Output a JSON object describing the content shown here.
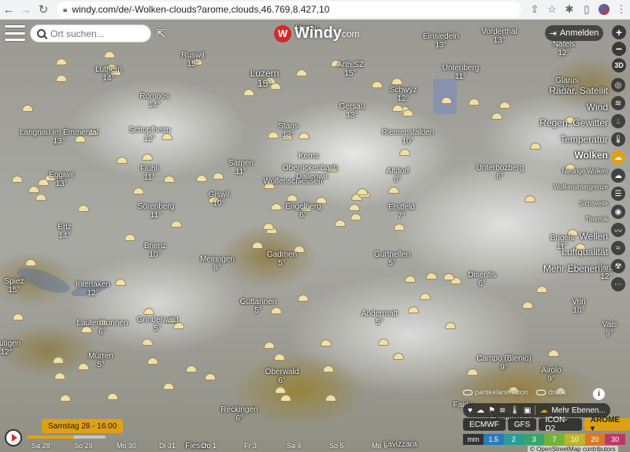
{
  "browser": {
    "url": "windy.com/de/-Wolken-clouds?arome,clouds,46.769,8.427,10"
  },
  "search": {
    "placeholder": "Ort suchen..."
  },
  "logo": {
    "name": "Windy",
    "suffix": "com"
  },
  "login": {
    "label": "Anmelden"
  },
  "zoom": {
    "in": "+",
    "out": "−",
    "mode3d": "3D"
  },
  "layers": [
    {
      "label": "Radar, Satellit",
      "size": "big"
    },
    {
      "label": "Wind",
      "size": "big"
    },
    {
      "label": "Regen, Gewitter",
      "size": "big"
    },
    {
      "label": "Temperatur",
      "size": "big"
    },
    {
      "label": "Wolken",
      "size": "big",
      "active": true
    },
    {
      "label": "Niedrige Wolken",
      "size": "small"
    },
    {
      "label": "Wolkenuntergrenze",
      "size": "small"
    },
    {
      "label": "Sichtweite",
      "size": "small"
    },
    {
      "label": "Thermik",
      "size": "small"
    },
    {
      "label": "Wellen",
      "size": "big"
    },
    {
      "label": "Luftqualität",
      "size": "big"
    },
    {
      "label": "Mehr Ebenen...",
      "size": "big"
    }
  ],
  "cities": [
    {
      "name": "Honau",
      "temp": ""
    },
    {
      "name": "Einsiedeln",
      "temp": "13°"
    },
    {
      "name": "Vorderthal",
      "temp": "13°"
    },
    {
      "name": "Näfels",
      "temp": "12°"
    },
    {
      "name": "Ruswil",
      "temp": "15°"
    },
    {
      "name": "Luthern",
      "temp": "14°"
    },
    {
      "name": "Luzern",
      "temp": "15°",
      "big": true
    },
    {
      "name": "Arth SZ",
      "temp": "15°"
    },
    {
      "name": "Unteriberg",
      "temp": "11°"
    },
    {
      "name": "Glarus",
      "temp": "13°"
    },
    {
      "name": "Schwyz",
      "temp": "12°"
    },
    {
      "name": "Romoos",
      "temp": "14°"
    },
    {
      "name": "Gersau",
      "temp": "13°"
    },
    {
      "name": "Langnau im Emmental",
      "temp": "13°"
    },
    {
      "name": "Schupfheim",
      "temp": "12°"
    },
    {
      "name": "Stans",
      "temp": "13°"
    },
    {
      "name": "Riemenstalden",
      "temp": "10°"
    },
    {
      "name": "Sarnen",
      "temp": "11°"
    },
    {
      "name": "Kerns",
      "temp": ""
    },
    {
      "name": "Wolfenschiessen",
      "temp": ""
    },
    {
      "name": "Dallenwil",
      "temp": ""
    },
    {
      "name": "Oberrickenbach",
      "temp": ""
    },
    {
      "name": "Altdorf",
      "temp": "8°"
    },
    {
      "name": "Unterbozberg",
      "temp": "6°"
    },
    {
      "name": "Eggiwil",
      "temp": "13°"
    },
    {
      "name": "Flühli",
      "temp": "11°"
    },
    {
      "name": "Giswil",
      "temp": "10°"
    },
    {
      "name": "Sörenberg",
      "temp": "11°"
    },
    {
      "name": "Engelberg",
      "temp": "6°"
    },
    {
      "name": "Erstfeld",
      "temp": "7°"
    },
    {
      "name": "Erlz",
      "temp": "14°"
    },
    {
      "name": "Brigels",
      "temp": "11°"
    },
    {
      "name": "Brienz",
      "temp": "10°"
    },
    {
      "name": "Meiringen",
      "temp": "8°"
    },
    {
      "name": "Gadmen",
      "temp": "5°"
    },
    {
      "name": "Gurtnellen",
      "temp": "5°"
    },
    {
      "name": "Ilanz",
      "temp": "12°"
    },
    {
      "name": "Spiez",
      "temp": "15°"
    },
    {
      "name": "Interlaken",
      "temp": "12°"
    },
    {
      "name": "Disentis",
      "temp": "6°"
    },
    {
      "name": "Guttannen",
      "temp": "5°"
    },
    {
      "name": "Andermatt",
      "temp": "5°"
    },
    {
      "name": "Vrin",
      "temp": "10°"
    },
    {
      "name": "Lauterbrunnen",
      "temp": "6°"
    },
    {
      "name": "Grindelwald",
      "temp": "5°"
    },
    {
      "name": "Vals",
      "temp": "9°"
    },
    {
      "name": "Frutigen",
      "temp": "12°"
    },
    {
      "name": "Mürren",
      "temp": "5°"
    },
    {
      "name": "Campo (Blenio)",
      "temp": "9°"
    },
    {
      "name": "Oberwald",
      "temp": "6°"
    },
    {
      "name": "Airolo",
      "temp": "9°"
    },
    {
      "name": "Faido",
      "temp": ""
    },
    {
      "name": "Reckingen",
      "temp": "6°"
    },
    {
      "name": "Acquarossa",
      "temp": ""
    },
    {
      "name": "Lavizzara",
      "temp": ""
    },
    {
      "name": "Fiesch",
      "temp": ""
    }
  ],
  "toggles": {
    "particles": "partikelanimation",
    "pressure": "druck"
  },
  "icon_row": {
    "more": "Mehr Ebenen..."
  },
  "products": [
    {
      "label": "ECMWF"
    },
    {
      "label": "GFS"
    },
    {
      "label": "ICON-D2"
    },
    {
      "label": "AROME ▾",
      "active": true
    }
  ],
  "scale": {
    "unit": "mm",
    "steps": [
      {
        "label": "1.5",
        "color": "#2b7bb9"
      },
      {
        "label": "2",
        "color": "#2f9a9a"
      },
      {
        "label": "3",
        "color": "#3aa56b"
      },
      {
        "label": "7",
        "color": "#71b43a"
      },
      {
        "label": "10",
        "color": "#c2b52e"
      },
      {
        "label": "20",
        "color": "#d67a2a"
      },
      {
        "label": "30",
        "color": "#b53a6a"
      }
    ]
  },
  "attribution": "© OpenStreetMap contributors",
  "timeline": {
    "current": "Samstag 28 - 16:00",
    "progress": 0.6,
    "days": [
      "Sa 28",
      "So 29",
      "Mo 30",
      "Di 31",
      "Do 1",
      "Fr 3",
      "Sa 4",
      "So 5",
      "Mo 6",
      "Di 7",
      "Mi 8",
      "Do 9",
      "Fr 10",
      "Sa 11"
    ]
  },
  "colors": {
    "accent": "#e0a016",
    "brand": "#d62828"
  }
}
